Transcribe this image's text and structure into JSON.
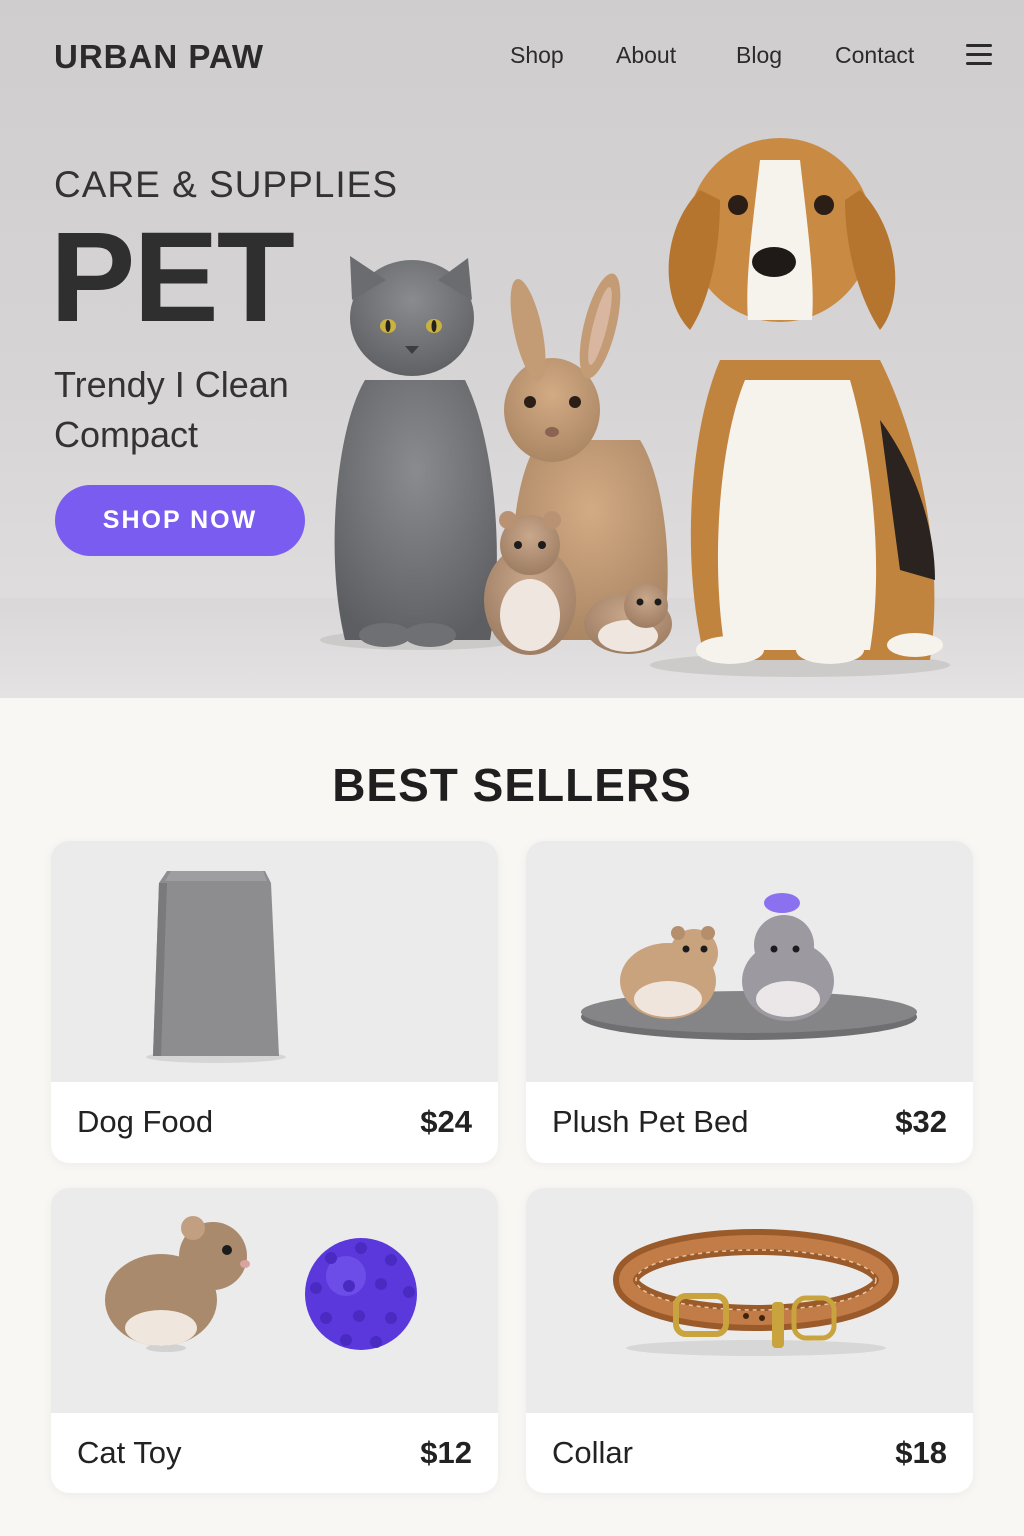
{
  "header": {
    "logo": "URBAN PAW",
    "nav": [
      "Shop",
      "About",
      "Blog",
      "Contact"
    ]
  },
  "hero": {
    "subtitle": "CARE & SUPPLIES",
    "title": "PET",
    "tagline": "Trendy I Clean Compact",
    "cta": "SHOP NOW"
  },
  "best_sellers": {
    "title": "BEST SELLERS",
    "products": [
      {
        "name": "Dog Food",
        "price": "$24"
      },
      {
        "name": "Plush Pet Bed",
        "price": "$32"
      },
      {
        "name": "Cat Toy",
        "price": "$12"
      },
      {
        "name": "Collar",
        "price": "$18"
      }
    ]
  },
  "colors": {
    "accent": "#7a5cf0",
    "hero_bg": "#d3d1d1",
    "page_bg": "#f8f7f4",
    "card_image_bg": "#ebebec"
  },
  "icons": [
    "menu-icon"
  ]
}
